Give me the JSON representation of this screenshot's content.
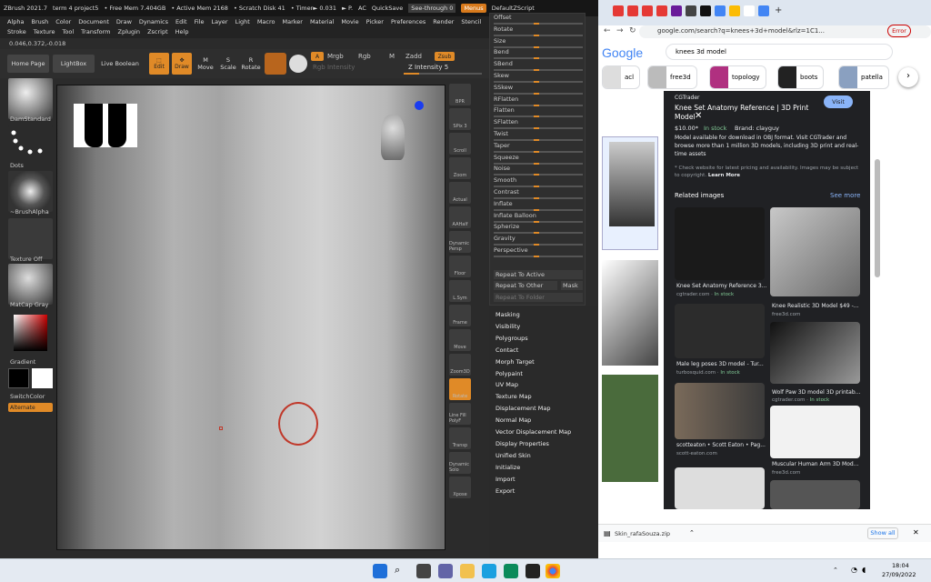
{
  "zbrush": {
    "titlebar": [
      "ZBrush 2021.7",
      "term 4 project5",
      "• Free Mem 7.404GB",
      "• Active Mem 2168",
      "• Scratch Disk 41",
      "• Timer► 0.031",
      "► P.",
      "AC"
    ],
    "quicksave": "QuickSave",
    "seethrough": "See-through  0",
    "menus": "Menus",
    "defaultscript": "DefaultZScript",
    "menus_list": [
      "Alpha",
      "Brush",
      "Color",
      "Document",
      "Draw",
      "Dynamics",
      "Edit",
      "File",
      "Layer",
      "Light",
      "Macro",
      "Marker",
      "Material",
      "Movie",
      "Picker",
      "Preferences",
      "Render",
      "Stencil",
      "Stroke",
      "Texture",
      "Tool",
      "Transform",
      "Zplugin",
      "Zscript",
      "Help"
    ],
    "coords": "0.046,0.372,-0.018",
    "toolbar": {
      "home": "Home Page",
      "lightbox": "LightBox",
      "liveboolean": "Live Boolean",
      "edit": "Edit",
      "draw": "Draw",
      "move": "Move",
      "scale": "Scale",
      "rotate": "Rotate",
      "a": "A",
      "mrgb": "Mrgb",
      "rgb": "Rgb",
      "m": "M",
      "zadd": "Zadd",
      "zsub": "Zsub",
      "rgb_intensity": "Rgb Intensity",
      "z_intensity": "Z Intensity 5"
    },
    "left": {
      "brush": "DamStandard",
      "stroke": "Dots",
      "alpha": "~BrushAlpha",
      "texture": "Texture Off",
      "material": "MatCap Gray",
      "gradient": "Gradient",
      "switchcolor": "SwitchColor",
      "alternate": "Alternate"
    },
    "right": [
      "BPR",
      "SPix 3",
      "Scroll",
      "Zoom",
      "Actual",
      "AAHalf",
      "Dynamic Persp",
      "Floor",
      "L.Sym",
      "Frame",
      "Move",
      "Zoom3D",
      "Rotate",
      "Line Fill PolyF",
      "Transp",
      "Dynamic Solo",
      "Xpose"
    ],
    "deformation": [
      "Offset",
      "Rotate",
      "Size",
      "Bend",
      "SBend",
      "Skew",
      "SSkew",
      "RFlatten",
      "Flatten",
      "SFlatten",
      "Twist",
      "Taper",
      "Squeeze",
      "Noise",
      "Smooth",
      "Contrast",
      "Inflate",
      "Inflate Balloon",
      "Spherize",
      "Gravity",
      "Perspective"
    ],
    "repeat": {
      "active": "Repeat To Active",
      "other": "Repeat To Other",
      "mask": "Mask",
      "folder": "Repeat To Folder"
    },
    "tool_menu": [
      "Masking",
      "Visibility",
      "Polygroups",
      "Contact",
      "Morph Target",
      "Polypaint",
      "UV Map",
      "Texture Map",
      "Displacement Map",
      "Normal Map",
      "Vector Displacement Map",
      "Display Properties",
      "Unified Skin",
      "Initialize",
      "Import",
      "Export"
    ]
  },
  "chrome": {
    "address": "google.com/search?q=knees+3d+model&rlz=1C1...",
    "error": "Error",
    "logo": "Google",
    "search": "knees 3d model",
    "chips": [
      "acl",
      "free3d",
      "topology",
      "boots",
      "patella"
    ],
    "panel": {
      "source": "CGTrader",
      "visit": "Visit",
      "title": "Knee Set Anatomy Reference | 3D Print Model",
      "price": "$10.00*",
      "instock": "In stock",
      "brand": "Brand: clayguy",
      "desc": "Model available for download in OBJ format. Visit CGTrader and browse more than 1 million 3D models, including 3D print and real-time assets",
      "note": "* Check website for latest pricing and availability. Images may be subject to copyright.",
      "learn": "Learn More",
      "related": "Related images",
      "seemore": "See more",
      "items": [
        {
          "title": "Knee Set Anatomy Reference 3...",
          "src": "cgtrader.com",
          "stock": "In stock"
        },
        {
          "title": "Knee Realistic 3D Model $49 -...",
          "src": "free3d.com",
          "stock": ""
        },
        {
          "title": "Male leg poses 3D model - Tur...",
          "src": "turbosquid.com",
          "stock": "In stock"
        },
        {
          "title": "Wolf Paw 3D model 3D printab...",
          "src": "cgtrader.com",
          "stock": "In stock"
        },
        {
          "title": "scotteaton • Scott Eaton • Pag...",
          "src": "scott-eaton.com",
          "stock": ""
        },
        {
          "title": "Muscular Human Arm 3D Mod...",
          "src": "free3d.com",
          "stock": ""
        }
      ]
    },
    "download": {
      "file": "Skin_rafaSouza.zip",
      "showall": "Show all"
    }
  },
  "taskbar": {
    "time": "18:04",
    "date": "27/09/2022"
  }
}
